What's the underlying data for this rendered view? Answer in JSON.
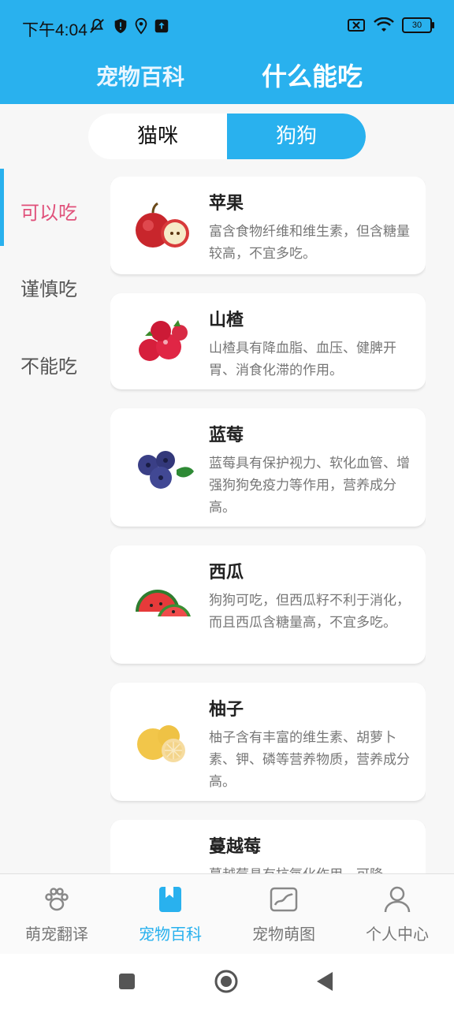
{
  "status_bar": {
    "time": "下午4:04",
    "battery": "30"
  },
  "header": {
    "tabs": [
      "宠物百科",
      "什么能吃"
    ],
    "active_tab_index": 1
  },
  "segment": {
    "options": [
      "猫咪",
      "狗狗"
    ],
    "selected": "狗狗"
  },
  "categories": {
    "items": [
      "可以吃",
      "谨慎吃",
      "不能吃"
    ],
    "selected": "可以吃"
  },
  "foods": [
    {
      "title": "苹果",
      "desc": "富含食物纤维和维生素，但含糖量较高，不宜多吃。",
      "image": "apple-icon"
    },
    {
      "title": "山楂",
      "desc": "山楂具有降血脂、血压、健脾开胃、消食化滞的作用。",
      "image": "hawthorn-icon"
    },
    {
      "title": "蓝莓",
      "desc": "蓝莓具有保护视力、软化血管、增强狗狗免疫力等作用，营养成分高。",
      "image": "blueberry-icon"
    },
    {
      "title": "西瓜",
      "desc": "狗狗可吃，但西瓜籽不利于消化，而且西瓜含糖量高，不宜多吃。",
      "image": "watermelon-icon"
    },
    {
      "title": "柚子",
      "desc": "柚子含有丰富的维生素、胡萝卜素、钾、磷等营养物质，营养成分高。",
      "image": "pomelo-icon"
    },
    {
      "title": "蔓越莓",
      "desc": "蔓越莓具有抗氧化作用，可降",
      "image": "cranberry-icon"
    }
  ],
  "bottom_nav": {
    "items": [
      "萌宠翻译",
      "宠物百科",
      "宠物萌图",
      "个人中心"
    ],
    "active": "宠物百科"
  },
  "colors": {
    "primary": "#29b1ee",
    "accent_pink": "#e0507a"
  }
}
